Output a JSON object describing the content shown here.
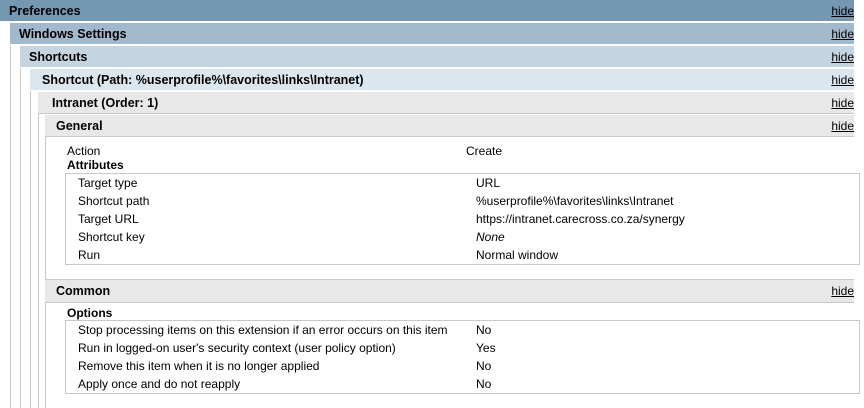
{
  "headers": [
    {
      "title": "Preferences",
      "hide": "hide",
      "color": "#7497b2"
    },
    {
      "title": "Windows Settings",
      "hide": "hide",
      "color": "#a2b8cc"
    },
    {
      "title": "Shortcuts",
      "hide": "hide",
      "color": "#c4d4e0"
    },
    {
      "title": "Shortcut (Path: %userprofile%\\favorites\\links\\Intranet)",
      "hide": "hide",
      "color": "#dce6ee"
    },
    {
      "title": "Intranet (Order: 1)",
      "hide": "hide",
      "color": "#e8e8e8"
    },
    {
      "title": "General",
      "hide": "hide",
      "color": "#e8e8e8"
    }
  ],
  "general": {
    "action_label": "Action",
    "action_value": "Create",
    "attributes_title": "Attributes",
    "attributes": [
      {
        "label": "Target type",
        "value": "URL"
      },
      {
        "label": "Shortcut path",
        "value": "%userprofile%\\favorites\\links\\Intranet"
      },
      {
        "label": "Target URL",
        "value": "https://intranet.carecross.co.za/synergy"
      },
      {
        "label": "Shortcut key",
        "value": "None"
      },
      {
        "label": "Run",
        "value": "Normal window"
      }
    ]
  },
  "common": {
    "title": "Common",
    "hide": "hide",
    "options_title": "Options",
    "options": [
      {
        "label": "Stop processing items on this extension if an error occurs on this item",
        "value": "No"
      },
      {
        "label": "Run in logged-on user's security context (user policy option)",
        "value": "Yes"
      },
      {
        "label": "Remove this item when it is no longer applied",
        "value": "No"
      },
      {
        "label": "Apply once and do not reapply",
        "value": "No"
      }
    ]
  }
}
